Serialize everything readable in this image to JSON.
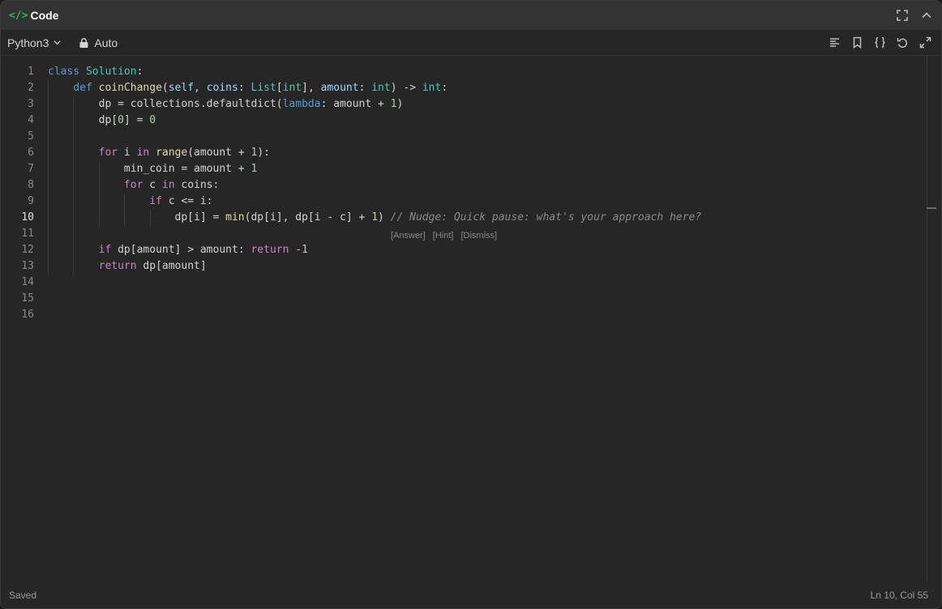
{
  "window": {
    "title_icon": "</>",
    "title": "Code",
    "expand_icon": "expand-icon",
    "collapse_icon": "chevron-up-icon"
  },
  "toolbar": {
    "language": "Python3",
    "mode": "Auto",
    "icons": [
      "format-icon",
      "bookmark-icon",
      "braces-icon",
      "undo-icon",
      "maximize-icon"
    ]
  },
  "editor": {
    "active_line": 10,
    "lines": [
      "class Solution:",
      "    def coinChange(self, coins: List[int], amount: int) -> int:",
      "        dp = collections.defaultdict(lambda: amount + 1)",
      "        dp[0] = 0",
      "",
      "        for i in range(amount + 1):",
      "            min_coin = amount + 1",
      "            for c in coins:",
      "                if c <= i:",
      "                    dp[i] = min(dp[i], dp[i - c] + 1) // Nudge: Quick pause: what's your approach here?",
      "",
      "        if dp[amount] > amount: return -1",
      "        return dp[amount]",
      "",
      "",
      ""
    ],
    "nudge": {
      "text": "// Nudge: Quick pause: what's your approach here?",
      "actions": [
        "[Answer]",
        "[Hint]",
        "[Dismiss]"
      ]
    }
  },
  "status": {
    "left": "Saved",
    "right": "Ln 10, Col 55"
  },
  "colors": {
    "keyword": "#c586c0",
    "keyword_blue": "#569cd6",
    "class": "#4ec9b0",
    "function": "#dcdcaa",
    "param": "#9cdcfe",
    "number": "#b5cea8",
    "accent_green": "#2db55d"
  }
}
